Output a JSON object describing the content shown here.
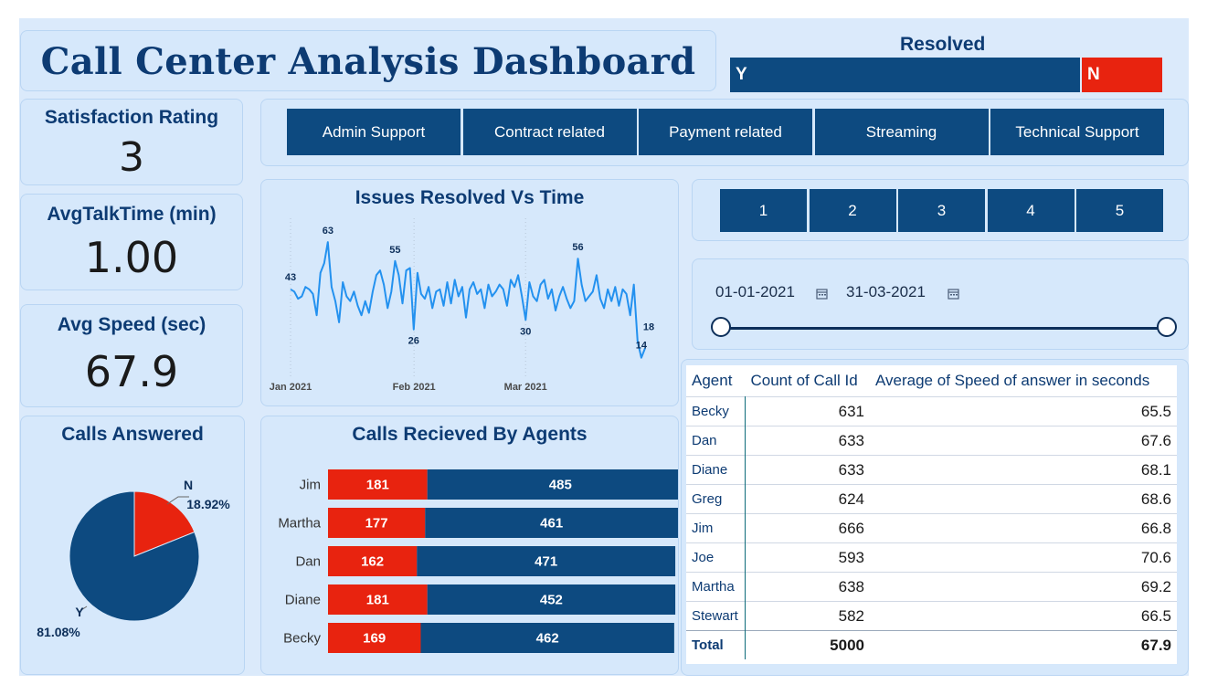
{
  "title": "Call Center Analysis Dashboard",
  "resolved": {
    "label": "Resolved",
    "yes_label": "Y",
    "no_label": "N",
    "yes_share": 0.81,
    "colors": {
      "yes": "#0d4a80",
      "no": "#e8230f"
    }
  },
  "kpis": {
    "satisfaction": {
      "label": "Satisfaction Rating",
      "value": "3"
    },
    "talk_time": {
      "label": "AvgTalkTime (min)",
      "value": "1.00"
    },
    "speed": {
      "label": "Avg Speed (sec)",
      "value": "67.9"
    }
  },
  "topics": [
    "Admin Support",
    "Contract related",
    "Payment related",
    "Streaming",
    "Technical Support"
  ],
  "ratings": [
    "1",
    "2",
    "3",
    "4",
    "5"
  ],
  "date_range": {
    "start": "01-01-2021",
    "end": "31-03-2021",
    "calendar_icon": "calendar-icon"
  },
  "line_panel_title": "Issues Resolved Vs Time",
  "bar_panel_title": "Calls Recieved By Agents",
  "pie_panel_title": "Calls Answered",
  "chart_data": [
    {
      "type": "line",
      "title": "Issues Resolved Vs Time",
      "x_ticks": [
        "Jan 2021",
        "Feb 2021",
        "Mar 2021"
      ],
      "x_start": "2021-01-01",
      "x_end": "2021-03-31",
      "values": [
        43,
        42,
        39,
        40,
        44,
        43,
        41,
        32,
        50,
        54,
        63,
        44,
        38,
        29,
        46,
        40,
        38,
        42,
        36,
        32,
        38,
        33,
        42,
        49,
        51,
        45,
        35,
        42,
        55,
        49,
        37,
        51,
        52,
        26,
        50,
        41,
        39,
        44,
        35,
        42,
        43,
        36,
        46,
        37,
        47,
        40,
        44,
        31,
        43,
        46,
        41,
        43,
        35,
        45,
        40,
        42,
        45,
        43,
        36,
        47,
        44,
        49,
        40,
        30,
        46,
        40,
        38,
        45,
        47,
        39,
        43,
        34,
        40,
        44,
        39,
        35,
        38,
        56,
        45,
        38,
        40,
        42,
        49,
        39,
        35,
        43,
        38,
        44,
        36,
        43,
        41,
        32,
        45,
        21,
        14,
        18
      ],
      "labeled_points": [
        {
          "label": "43",
          "index": 0
        },
        {
          "label": "63",
          "index": 10
        },
        {
          "label": "55",
          "index": 28
        },
        {
          "label": "26",
          "index": 33
        },
        {
          "label": "30",
          "index": 63
        },
        {
          "label": "56",
          "index": 77
        },
        {
          "label": "14",
          "index": 94
        },
        {
          "label": "18",
          "index": 95
        }
      ],
      "ylim": [
        10,
        70
      ],
      "color": "#2391ef"
    },
    {
      "type": "bar",
      "title": "Calls Recieved By Agents",
      "orientation": "horizontal",
      "stacked": true,
      "categories": [
        "Jim",
        "Martha",
        "Dan",
        "Diane",
        "Becky"
      ],
      "series": [
        {
          "values": [
            181,
            177,
            162,
            181,
            169
          ],
          "color": "#e8230f"
        },
        {
          "values": [
            485,
            461,
            471,
            452,
            462
          ],
          "color": "#0d4a80"
        }
      ]
    },
    {
      "type": "pie",
      "title": "Calls Answered",
      "slices": [
        {
          "label": "N",
          "value": 18.92,
          "display": "18.92%",
          "color": "#e8230f"
        },
        {
          "label": "Y",
          "value": 81.08,
          "display": "81.08%",
          "color": "#0d4a80"
        }
      ]
    }
  ],
  "agent_table": {
    "columns": [
      "Agent",
      "Count of Call Id",
      "Average of Speed of answer in seconds"
    ],
    "rows": [
      [
        "Becky",
        "631",
        "65.5"
      ],
      [
        "Dan",
        "633",
        "67.6"
      ],
      [
        "Diane",
        "633",
        "68.1"
      ],
      [
        "Greg",
        "624",
        "68.6"
      ],
      [
        "Jim",
        "666",
        "66.8"
      ],
      [
        "Joe",
        "593",
        "70.6"
      ],
      [
        "Martha",
        "638",
        "69.2"
      ],
      [
        "Stewart",
        "582",
        "66.5"
      ]
    ],
    "total": [
      "Total",
      "5000",
      "67.9"
    ]
  }
}
